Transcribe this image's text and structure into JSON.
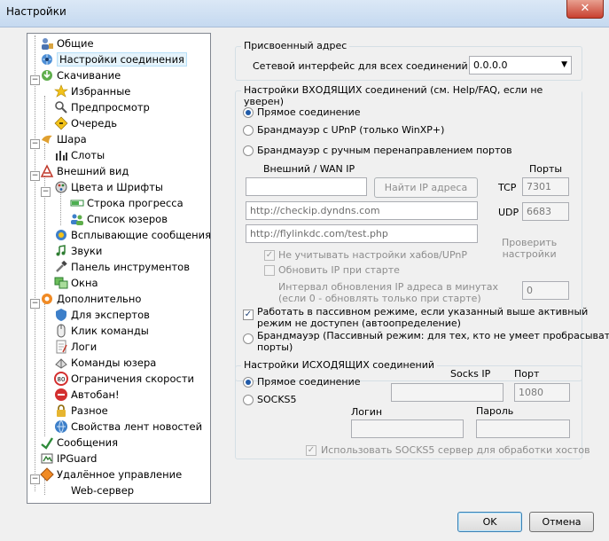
{
  "window": {
    "title": "Настройки",
    "close_glyph": "✕"
  },
  "tree": {
    "items": [
      {
        "label": "Общие",
        "icon": "general-icon"
      },
      {
        "label": "Настройки соединения",
        "icon": "connection-icon"
      },
      {
        "label": "Скачивание",
        "icon": "download-icon"
      },
      {
        "label": "Избранные",
        "icon": "star-icon"
      },
      {
        "label": "Предпросмотр",
        "icon": "preview-icon"
      },
      {
        "label": "Очередь",
        "icon": "queue-icon"
      },
      {
        "label": "Шара",
        "icon": "share-icon"
      },
      {
        "label": "Слоты",
        "icon": "slots-icon"
      },
      {
        "label": "Внешний вид",
        "icon": "appearance-icon"
      },
      {
        "label": "Цвета и Шрифты",
        "icon": "palette-icon"
      },
      {
        "label": "Строка прогресса",
        "icon": "progress-icon"
      },
      {
        "label": "Список юзеров",
        "icon": "users-icon"
      },
      {
        "label": "Всплывающие сообщения",
        "icon": "popup-icon"
      },
      {
        "label": "Звуки",
        "icon": "sound-icon"
      },
      {
        "label": "Панель инструментов",
        "icon": "toolbar-icon"
      },
      {
        "label": "Окна",
        "icon": "windows-icon"
      },
      {
        "label": "Дополнительно",
        "icon": "advanced-icon"
      },
      {
        "label": "Для экспертов",
        "icon": "expert-icon"
      },
      {
        "label": "Клик команды",
        "icon": "click-command-icon"
      },
      {
        "label": "Логи",
        "icon": "logs-icon"
      },
      {
        "label": "Команды юзера",
        "icon": "user-commands-icon"
      },
      {
        "label": "Ограничения скорости",
        "icon": "speed-limit-icon"
      },
      {
        "label": "Автобан!",
        "icon": "autoban-icon"
      },
      {
        "label": "Разное",
        "icon": "lock-icon"
      },
      {
        "label": "Свойства лент новостей",
        "icon": "rss-icon"
      },
      {
        "label": "Сообщения",
        "icon": "messages-icon"
      },
      {
        "label": "IPGuard",
        "icon": "ipguard-icon"
      },
      {
        "label": "Удалённое управление",
        "icon": "remote-icon"
      },
      {
        "label": "Web-сервер",
        "icon": "webserver-icon"
      }
    ]
  },
  "assigned": {
    "legend": "Присвоенный адрес",
    "interface_label": "Сетевой интерфейс для всех соединений",
    "interface_value": "0.0.0.0"
  },
  "incoming": {
    "legend": "Настройки ВХОДЯЩИХ соединений (см. Help/FAQ, если не уверен)",
    "radio_direct": "Прямое соединение",
    "radio_upnp": "Брандмауэр с UPnP (только WinXP+)",
    "radio_manual": "Брандмауэр с ручным перенаправлением портов",
    "wan_ip_label": "Внешний / WAN IP",
    "ports_label": "Порты",
    "wan_ip_value": "",
    "find_ip_button": "Найти IP адреса",
    "tcp_label": "TCP",
    "tcp_value": "7301",
    "udp_label": "UDP",
    "udp_value": "6683",
    "url1": "http://checkip.dyndns.com",
    "url2": "http://flylinkdc.com/test.php",
    "ignore_hub_upnp": "Не учитывать настройки хабов/UPnP",
    "update_ip_start": "Обновить IP при старте",
    "check_settings": "Проверить\nнастройки",
    "interval_line1": "Интервал обновления IP адреса в минутах",
    "interval_line2": "(если 0 - обновлять только при старте)",
    "interval_value": "0",
    "passive_line1": "Работать в пассивном режиме, если указанный выше активный",
    "passive_line2": "режим не доступен (автоопределение)",
    "passive_fw_line1": "Брандмауэр (Пассивный режим: для тех, кто не умеет пробрасывать",
    "passive_fw_line2": "порты)"
  },
  "outgoing": {
    "legend": "Настройки ИСХОДЯЩИХ соединений",
    "radio_direct": "Прямое соединение",
    "radio_socks": "SOCKS5",
    "socks_ip_label": "Socks IP",
    "port_label": "Порт",
    "port_value": "1080",
    "socks_ip_value": "",
    "login_label": "Логин",
    "login_value": "",
    "password_label": "Пароль",
    "password_value": "",
    "use_socks_hosts": "Использовать SOCKS5 сервер для обработки хостов"
  },
  "footer": {
    "ok": "OK",
    "cancel": "Отмена"
  }
}
